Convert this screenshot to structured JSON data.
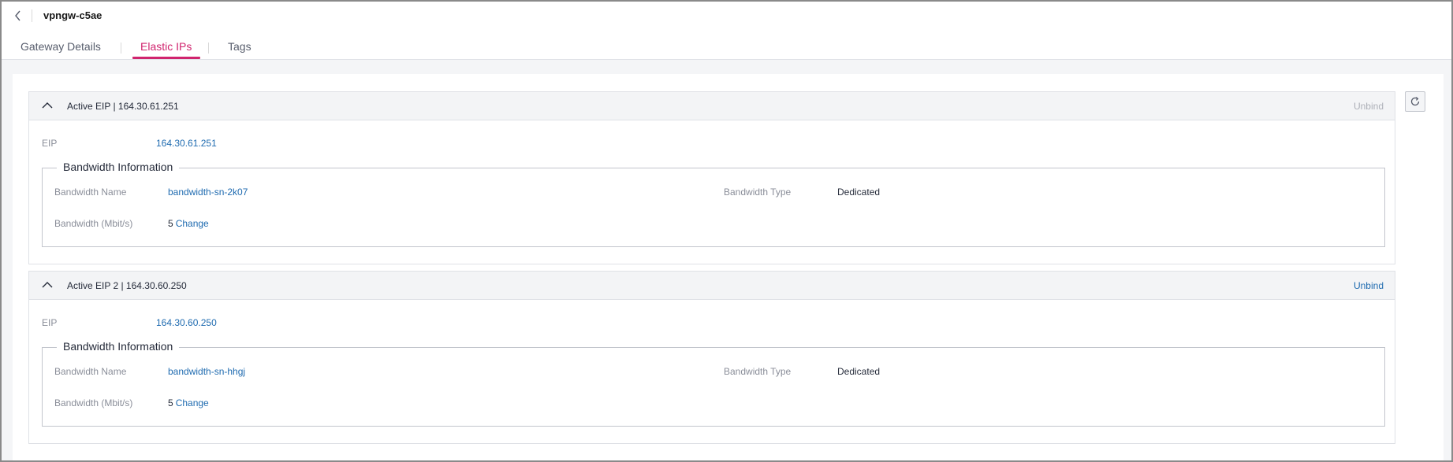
{
  "header": {
    "title": "vpngw-c5ae",
    "tabs": [
      {
        "label": "Gateway Details"
      },
      {
        "label": "Elastic IPs"
      },
      {
        "label": "Tags"
      }
    ]
  },
  "panels": [
    {
      "title": "Active EIP | 164.30.61.251",
      "unbind_label": "Unbind",
      "unbind_enabled": false,
      "eip_label": "EIP",
      "eip_value": "164.30.61.251",
      "bandwidth": {
        "legend": "Bandwidth Information",
        "name_label": "Bandwidth Name",
        "name_value": "bandwidth-sn-2k07",
        "type_label": "Bandwidth Type",
        "type_value": "Dedicated",
        "size_label": "Bandwidth (Mbit/s)",
        "size_value": "5",
        "change_label": "Change"
      }
    },
    {
      "title": "Active EIP 2 | 164.30.60.250",
      "unbind_label": "Unbind",
      "unbind_enabled": true,
      "eip_label": "EIP",
      "eip_value": "164.30.60.250",
      "bandwidth": {
        "legend": "Bandwidth Information",
        "name_label": "Bandwidth Name",
        "name_value": "bandwidth-sn-hhgj",
        "type_label": "Bandwidth Type",
        "type_value": "Dedicated",
        "size_label": "Bandwidth (Mbit/s)",
        "size_value": "5",
        "change_label": "Change"
      }
    }
  ],
  "icons": {
    "back": "chevron-left-icon",
    "collapse": "chevron-up-icon",
    "refresh": "refresh-icon"
  },
  "colors": {
    "accent": "#d0246e",
    "link": "#1f6bb0",
    "disabled": "#adb0b8"
  }
}
